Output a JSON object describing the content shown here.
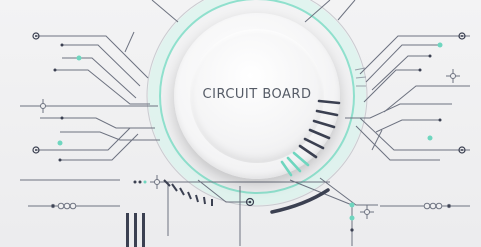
{
  "title": "CIRCUIT BOARD",
  "colors": {
    "background": "#efeff1",
    "trace": "#6d7280",
    "accent": "#6fd6bf",
    "dark": "#3b4051"
  },
  "icons": [
    "node-dot",
    "crosshair-icon",
    "connector-chain-icon",
    "tick-arc"
  ]
}
